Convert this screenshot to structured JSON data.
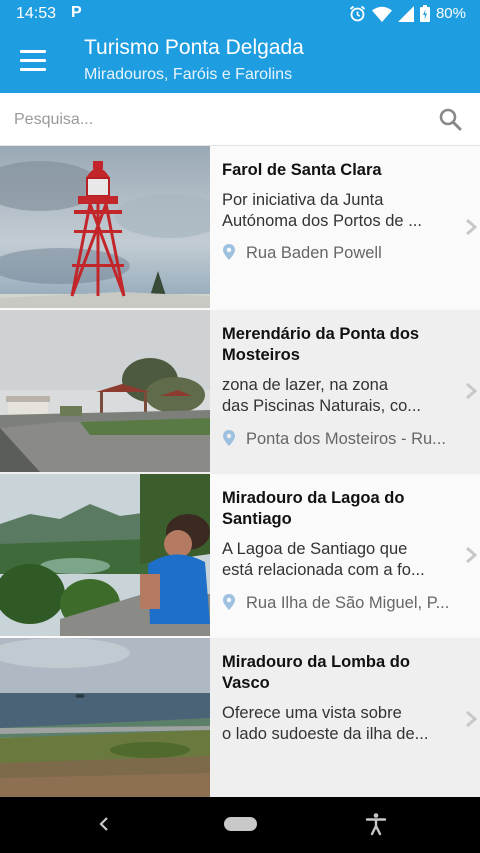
{
  "status_bar": {
    "time": "14:53",
    "p_icon": "P",
    "battery": "80%",
    "icons": [
      "p-app-icon",
      "alarm-icon",
      "wifi-icon",
      "signal-icon",
      "battery-icon"
    ]
  },
  "app_bar": {
    "title": "Turismo Ponta Delgada",
    "subtitle": "Miradouros, Faróis e Farolins",
    "menu_icon": "hamburger-menu-icon",
    "color": "#1e9de0"
  },
  "search": {
    "placeholder": "Pesquisa...",
    "value": "",
    "icon": "search-icon"
  },
  "items": [
    {
      "title": "Farol de Santa Clara",
      "desc_lines": [
        "Por iniciativa da Junta",
        "Autónoma dos Portos de ..."
      ],
      "location": "Rua Baden Powell",
      "image": "red-lighthouse-photo"
    },
    {
      "title": "Merendário da Ponta dos Mosteiros",
      "desc_lines": [
        "zona de lazer, na zona",
        "das Piscinas Naturais, co..."
      ],
      "location": "Ponta dos Mosteiros - Ru...",
      "image": "picnic-park-photo"
    },
    {
      "title": "Miradouro da Lagoa do Santiago",
      "desc_lines": [
        "A Lagoa de Santiago que",
        "está relacionada com a fo..."
      ],
      "location": "Rua Ilha de São Miguel, P...",
      "image": "lagoon-viewpoint-photo"
    },
    {
      "title": "Miradouro da Lomba do Vasco",
      "desc_lines": [
        "Oferece uma vista sobre",
        "o lado sudoeste da ilha de..."
      ],
      "location": "",
      "image": "sea-viewpoint-photo"
    }
  ],
  "nav_bar": {
    "icons": [
      "back-icon",
      "home-pill-icon",
      "accessibility-icon"
    ]
  }
}
